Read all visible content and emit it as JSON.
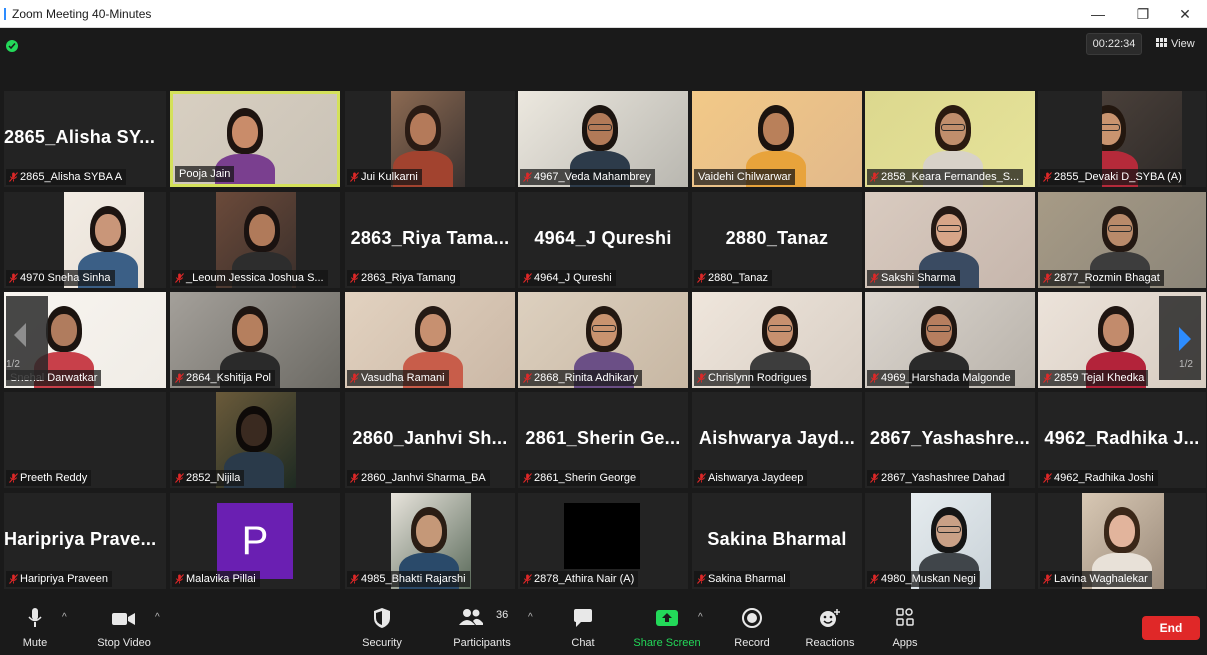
{
  "window": {
    "title": "Zoom Meeting 40-Minutes",
    "minimize": "—",
    "restore": "❐",
    "close": "✕"
  },
  "meeting": {
    "timer": "00:22:34",
    "view_label": "View"
  },
  "pages": {
    "current": "1/2",
    "current_right": "1/2"
  },
  "tiles": [
    {
      "name": "2865_Alisha SYBA A",
      "big": "2865_Alisha SY...",
      "muted": true
    },
    {
      "name": "Pooja Jain",
      "big": "",
      "muted": false,
      "active": true
    },
    {
      "name": "Jui Kulkarni",
      "big": "",
      "muted": true
    },
    {
      "name": "4967_Veda Mahambrey",
      "big": "",
      "muted": true
    },
    {
      "name": "Vaidehi Chilwarwar",
      "big": "",
      "muted": false
    },
    {
      "name": "2858_Keara Fernandes_S...",
      "big": "",
      "muted": true
    },
    {
      "name": "2855_Devaki D_SYBA (A)",
      "big": "",
      "muted": true
    },
    {
      "name": "4970 Sneha Sinha",
      "big": "",
      "muted": true
    },
    {
      "name": "_Leoum Jessica Joshua S...",
      "big": "",
      "muted": true
    },
    {
      "name": "2863_Riya Tamang",
      "big": "2863_Riya Tama...",
      "muted": true
    },
    {
      "name": "4964_J Qureshi",
      "big": "4964_J Qureshi",
      "muted": true
    },
    {
      "name": "2880_Tanaz",
      "big": "2880_Tanaz",
      "muted": true
    },
    {
      "name": "Sakshi Sharma",
      "big": "",
      "muted": true
    },
    {
      "name": "2877_Rozmin Bhagat",
      "big": "",
      "muted": true
    },
    {
      "name": "Snehal Darwatkar",
      "big": "",
      "muted": false
    },
    {
      "name": "2864_Kshitija Pol",
      "big": "",
      "muted": true
    },
    {
      "name": "Vasudha Ramani",
      "big": "",
      "muted": true
    },
    {
      "name": "2868_Rinita Adhikary",
      "big": "",
      "muted": true
    },
    {
      "name": "Chrislynn Rodrigues",
      "big": "",
      "muted": true
    },
    {
      "name": "4969_Harshada Malgonde",
      "big": "",
      "muted": true
    },
    {
      "name": "2859 Tejal Khedka",
      "big": "",
      "muted": true
    },
    {
      "name": "Preeth Reddy",
      "big": "",
      "muted": true
    },
    {
      "name": "2852_Nijila",
      "big": "",
      "muted": true
    },
    {
      "name": "2860_Janhvi Sharma_BA",
      "big": "2860_Janhvi Sh...",
      "muted": true
    },
    {
      "name": "2861_Sherin George",
      "big": "2861_Sherin Ge...",
      "muted": true
    },
    {
      "name": "Aishwarya Jaydeep",
      "big": "Aishwarya Jayd...",
      "muted": true
    },
    {
      "name": "2867_Yashashree Dahad",
      "big": "2867_Yashashre...",
      "muted": true
    },
    {
      "name": "4962_Radhika Joshi",
      "big": "4962_Radhika J...",
      "muted": true
    },
    {
      "name": "Haripriya Praveen",
      "big": "Haripriya Prave...",
      "muted": true
    },
    {
      "name": "Malavika Pillai",
      "big": "",
      "muted": true,
      "avatar_letter": "P"
    },
    {
      "name": "4985_Bhakti Rajarshi",
      "big": "",
      "muted": true
    },
    {
      "name": "2878_Athira Nair (A)",
      "big": "",
      "muted": true
    },
    {
      "name": "Sakina Bharmal",
      "big": "Sakina Bharmal",
      "muted": true
    },
    {
      "name": "4980_Muskan Negi",
      "big": "",
      "muted": true
    },
    {
      "name": "Lavina Waghalekar",
      "big": "",
      "muted": true
    }
  ],
  "toolbar": {
    "mute": "Mute",
    "stop_video": "Stop Video",
    "security": "Security",
    "participants": "Participants",
    "participants_count": "36",
    "chat": "Chat",
    "share_screen": "Share Screen",
    "record": "Record",
    "reactions": "Reactions",
    "apps": "Apps",
    "end": "End"
  },
  "colors": {
    "background": "#1a1a1a",
    "tile": "#232323",
    "active_speaker_border": "#d4e15a",
    "share_green": "#23d959",
    "end_red": "#e02828",
    "mute_icon_red": "#e02828",
    "avatar_purple": "#6a1fb2"
  }
}
